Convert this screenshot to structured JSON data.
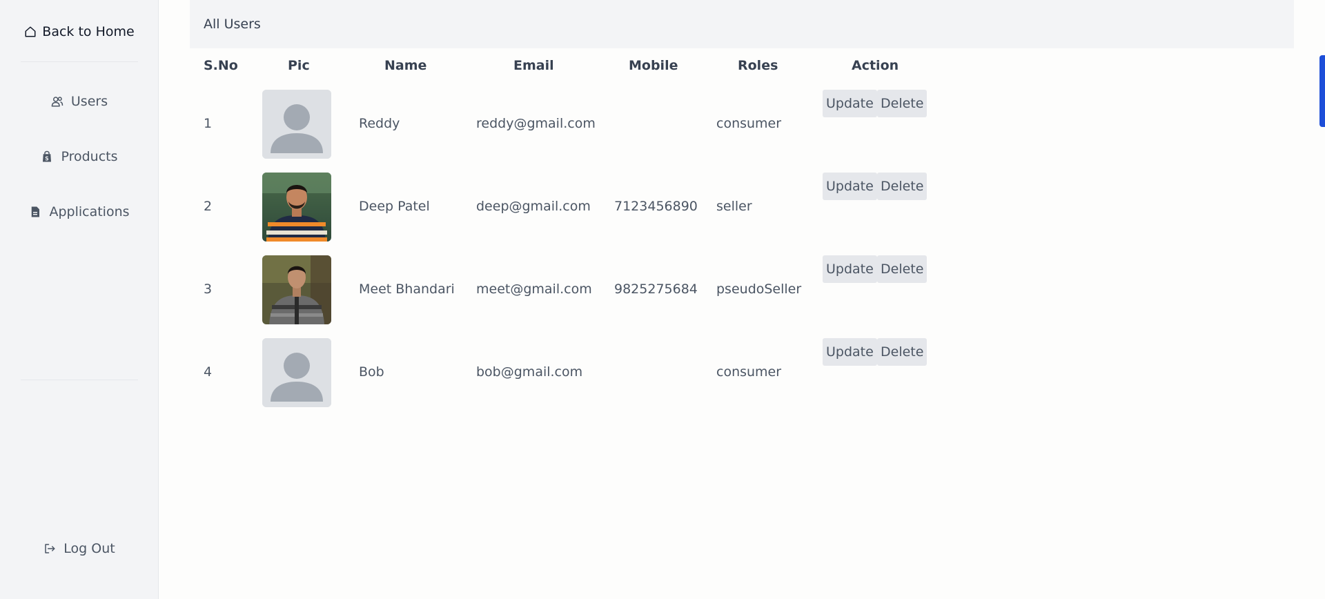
{
  "sidebar": {
    "home_label": "Back to Home",
    "items": [
      {
        "label": "Users",
        "icon": "users-icon"
      },
      {
        "label": "Products",
        "icon": "shopping-bag-icon"
      },
      {
        "label": "Applications",
        "icon": "document-icon"
      }
    ],
    "logout_label": "Log Out"
  },
  "header": {
    "title": "All Users"
  },
  "table": {
    "columns": [
      "S.No",
      "Pic",
      "Name",
      "Email",
      "Mobile",
      "Roles",
      "Action"
    ],
    "rows": [
      {
        "sno": "1",
        "pic": "default-avatar",
        "name": "Reddy",
        "email": "reddy@gmail.com",
        "mobile": "",
        "role": "consumer"
      },
      {
        "sno": "2",
        "pic": "photo",
        "name": "Deep Patel",
        "email": "deep@gmail.com",
        "mobile": "7123456890",
        "role": "seller"
      },
      {
        "sno": "3",
        "pic": "photo",
        "name": "Meet Bhandari",
        "email": "meet@gmail.com",
        "mobile": "9825275684",
        "role": "pseudoSeller"
      },
      {
        "sno": "4",
        "pic": "default-avatar",
        "name": "Bob",
        "email": "bob@gmail.com",
        "mobile": "",
        "role": "consumer"
      }
    ],
    "update_label": "Update",
    "delete_label": "Delete"
  },
  "colors": {
    "sidebar_bg": "#f3f4f6",
    "header_bg": "#f3f4f6",
    "button_bg": "#e5e7eb",
    "scroll_accent": "#1d4ed8"
  }
}
